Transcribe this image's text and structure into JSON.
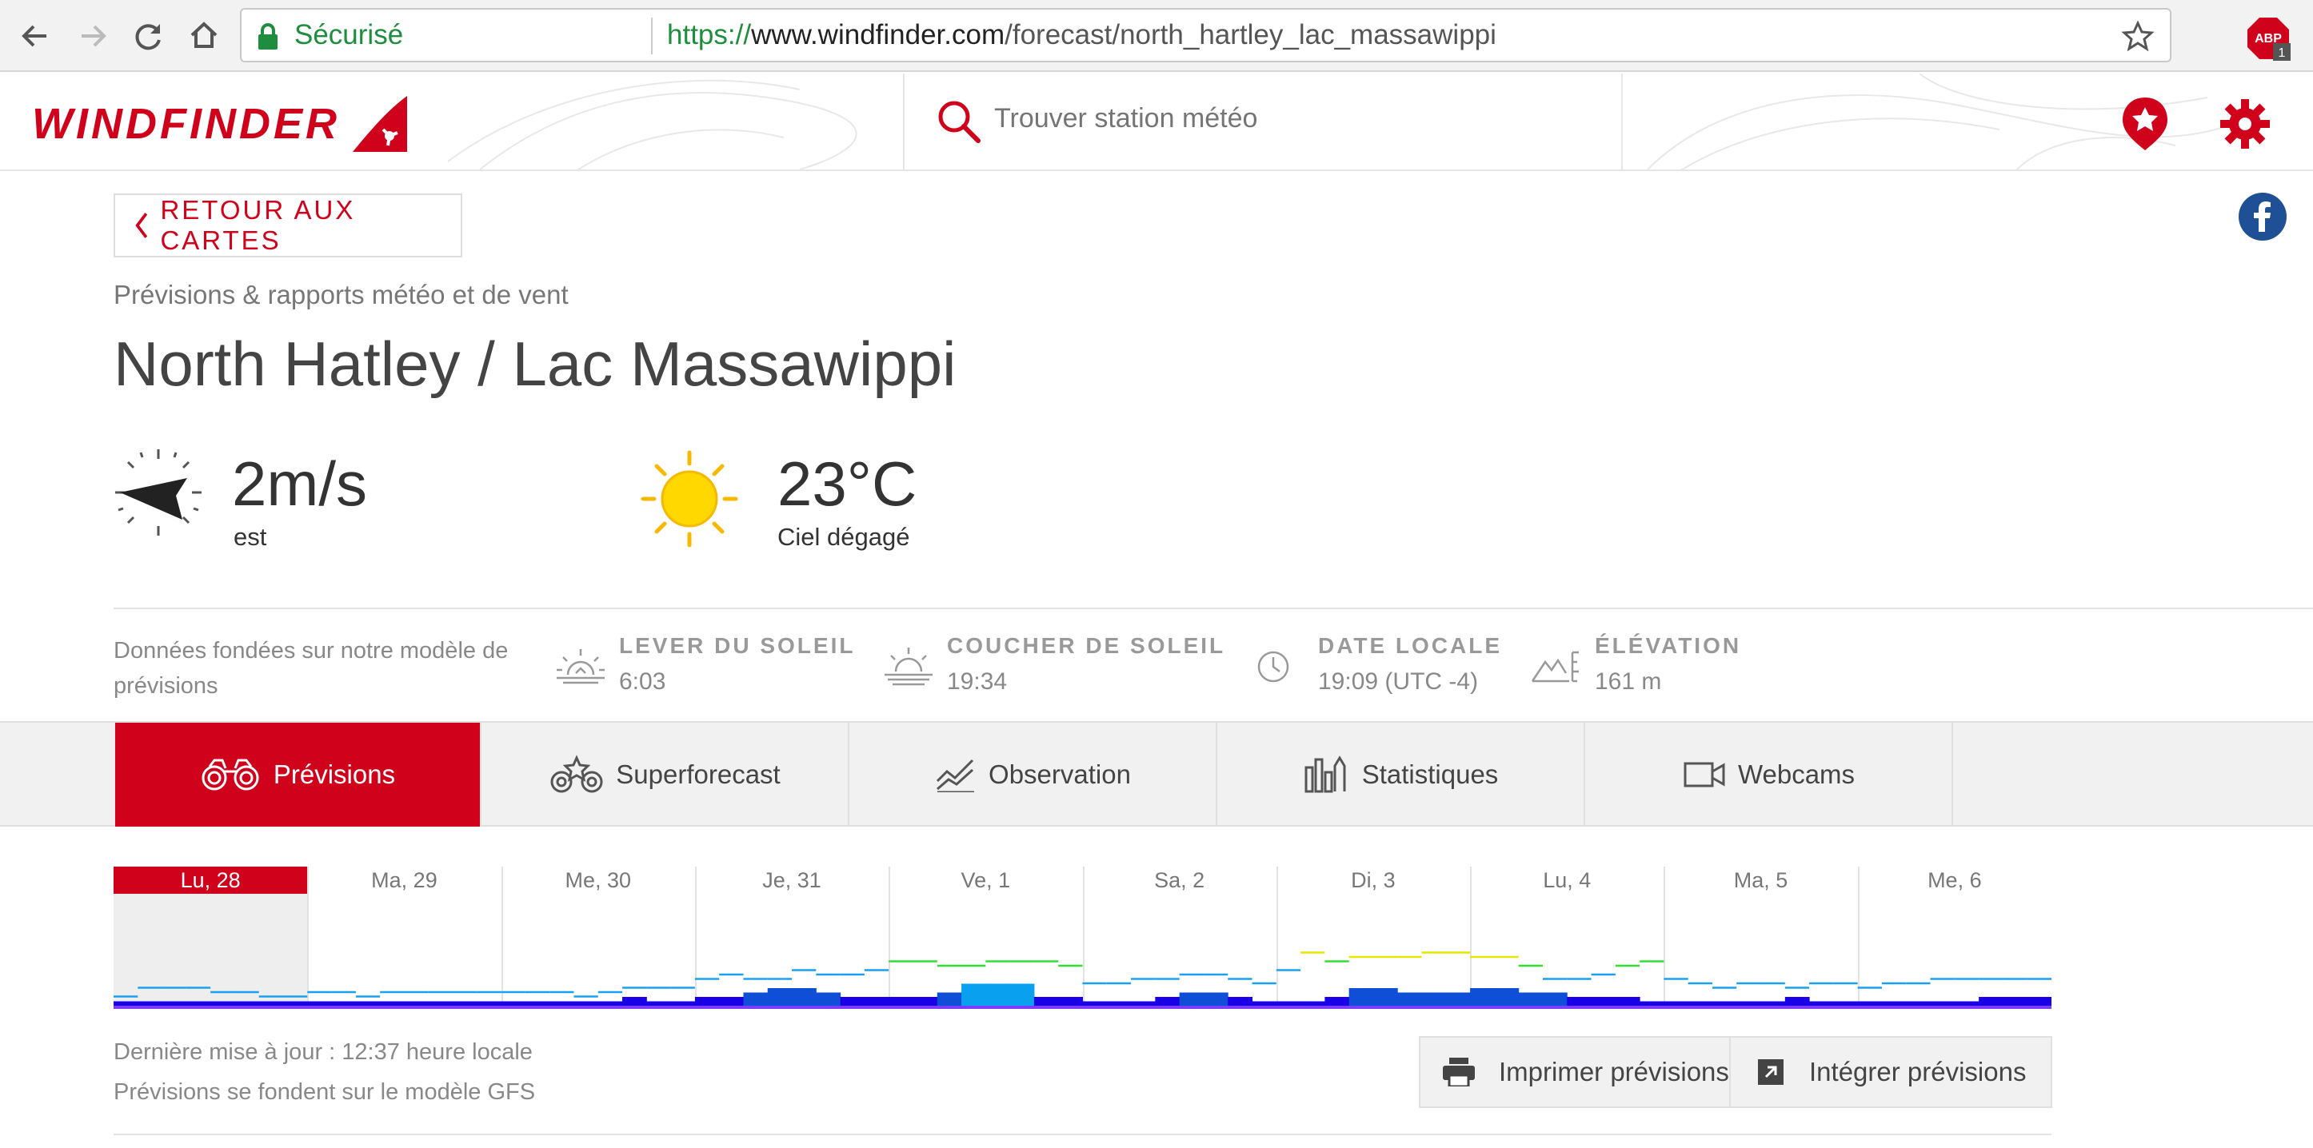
{
  "browser": {
    "secure_label": "Sécurisé",
    "url_scheme": "https://",
    "url_host": "www.windfinder.com",
    "url_path": "/forecast/north_hartley_lac_massawippi",
    "extension_badge": "ABP",
    "extension_count": "1"
  },
  "header": {
    "logo_text": "WINDFINDER",
    "search_placeholder": "Trouver station météo"
  },
  "nav": {
    "back_label": "RETOUR AUX CARTES"
  },
  "spot": {
    "subtitle": "Prévisions & rapports météo et de vent",
    "title": "North Hatley / Lac Massawippi"
  },
  "current": {
    "wind_speed": "2m/s",
    "wind_direction": "est",
    "temperature": "23°C",
    "sky": "Ciel dégagé"
  },
  "info": {
    "note": "Données fondées sur notre modèle de prévisions",
    "sunrise_label": "LEVER DU SOLEIL",
    "sunrise_value": "6:03",
    "sunset_label": "COUCHER DE SOLEIL",
    "sunset_value": "19:34",
    "localdate_label": "DATE LOCALE",
    "localdate_value": "19:09  (UTC -4)",
    "elevation_label": "ÉLÉVATION",
    "elevation_value": "161 m"
  },
  "tabs": [
    {
      "label": "Prévisions",
      "icon": "binoculars-icon",
      "active": true
    },
    {
      "label": "Superforecast",
      "icon": "binoculars-star-icon",
      "active": false
    },
    {
      "label": "Observation",
      "icon": "line-chart-icon",
      "active": false
    },
    {
      "label": "Statistiques",
      "icon": "bar-chart-icon",
      "active": false
    },
    {
      "label": "Webcams",
      "icon": "video-camera-icon",
      "active": false
    }
  ],
  "forecast_days": [
    {
      "label": "Lu, 28",
      "today": true
    },
    {
      "label": "Ma, 29",
      "today": false
    },
    {
      "label": "Me, 30",
      "today": false
    },
    {
      "label": "Je, 31",
      "today": false
    },
    {
      "label": "Ve, 1",
      "today": false
    },
    {
      "label": "Sa, 2",
      "today": false
    },
    {
      "label": "Di, 3",
      "today": false
    },
    {
      "label": "Lu, 4",
      "today": false
    },
    {
      "label": "Ma, 5",
      "today": false
    },
    {
      "label": "Me, 6",
      "today": false
    }
  ],
  "chart_data": {
    "type": "bar",
    "note": "Mini wind strip: per-day relative wind level segments (bars) and gust levels (lines), unitless 0-10 scale",
    "days": [
      "Lu, 28",
      "Ma, 29",
      "Me, 30",
      "Je, 31",
      "Ve, 1",
      "Sa, 2",
      "Di, 3",
      "Lu, 4",
      "Ma, 5",
      "Me, 6"
    ],
    "series": [
      {
        "values": [
          [
            1,
            1,
            1,
            1,
            1,
            1,
            1,
            1
          ],
          [
            1,
            1,
            1,
            1,
            1,
            1,
            1,
            1
          ],
          [
            1,
            1,
            1,
            1,
            1,
            2,
            1,
            1
          ],
          [
            2,
            2,
            3,
            4,
            4,
            3,
            2,
            2
          ],
          [
            2,
            2,
            3,
            5,
            5,
            5,
            2,
            2
          ],
          [
            1,
            1,
            1,
            2,
            3,
            3,
            2,
            1
          ],
          [
            1,
            1,
            2,
            4,
            4,
            3,
            3,
            3
          ],
          [
            4,
            4,
            3,
            3,
            2,
            2,
            2,
            1
          ],
          [
            1,
            1,
            1,
            1,
            1,
            2,
            1,
            1
          ],
          [
            1,
            1,
            1,
            1,
            1,
            2,
            2,
            2
          ]
        ]
      },
      {
        "values": [
          [
            1,
            3,
            3,
            3,
            2,
            2,
            1,
            1
          ],
          [
            2,
            2,
            1,
            2,
            2,
            2,
            2,
            2
          ],
          [
            2,
            2,
            2,
            1,
            2,
            3,
            3,
            3
          ],
          [
            5,
            6,
            5,
            5,
            7,
            6,
            6,
            7
          ],
          [
            9,
            9,
            8,
            8,
            9,
            9,
            9,
            8
          ],
          [
            4,
            4,
            5,
            5,
            6,
            6,
            5,
            4
          ],
          [
            7,
            11,
            9,
            10,
            10,
            10,
            11,
            11
          ],
          [
            10,
            10,
            8,
            5,
            5,
            6,
            8,
            9
          ],
          [
            5,
            4,
            3,
            4,
            4,
            3,
            4,
            4
          ],
          [
            3,
            4,
            4,
            5,
            5,
            5,
            5,
            5
          ]
        ]
      }
    ],
    "colors": {
      "wind_low": "#1a00e6",
      "wind_mid": "#0f4fd8",
      "wind_high": "#0aa0f0",
      "gust_blue": "#1aa0f0",
      "gust_green": "#33dd33",
      "gust_yellow": "#e6e600",
      "baseline": "#7a3cff"
    }
  },
  "footer": {
    "updated": "Dernière mise à jour : 12:37 heure locale",
    "model": "Prévisions se fondent sur le modèle GFS",
    "print_label": "Imprimer prévisions",
    "embed_label": "Intégrer prévisions"
  }
}
